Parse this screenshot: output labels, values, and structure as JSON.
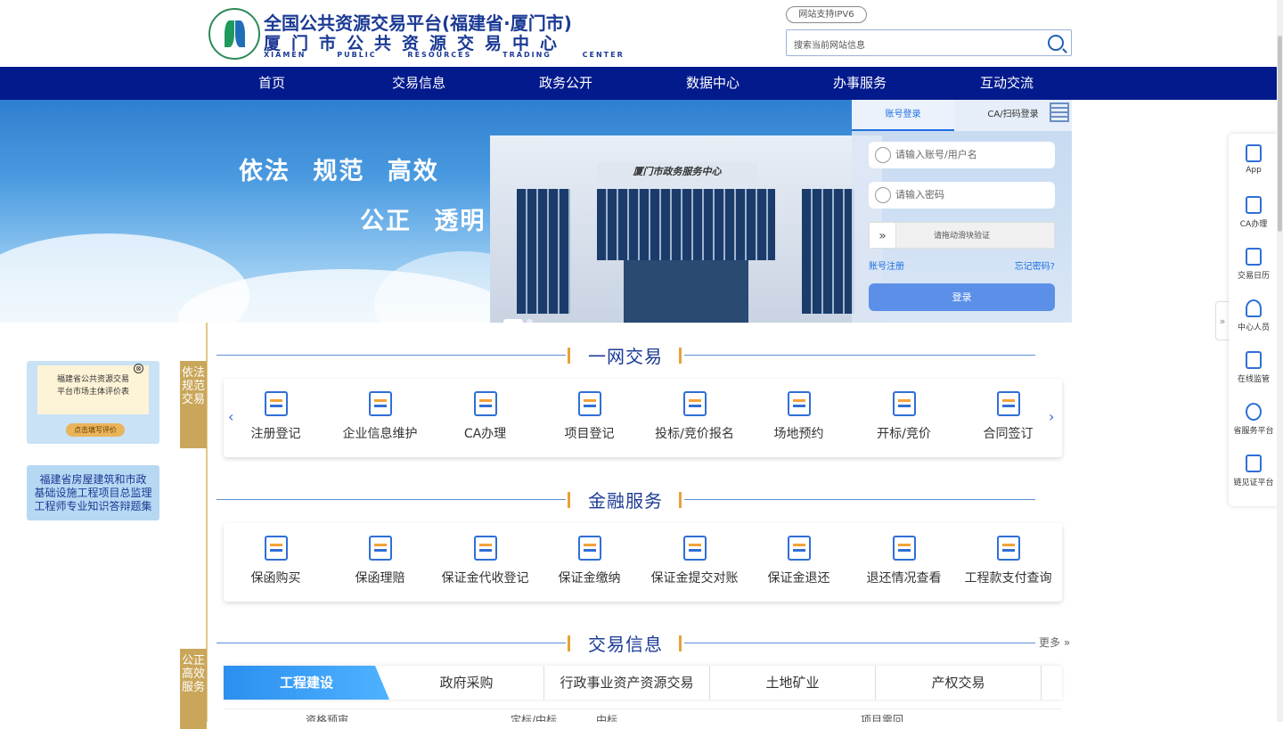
{
  "header": {
    "title_line1": "全国公共资源交易平台(福建省·厦门市)",
    "title_line2": "厦门市公共资源交易中心",
    "title_line3": "XIAMEN PUBLIC RESOURCES TRADING CENTER",
    "ipv6": "网站支持IPV6",
    "search_placeholder": "搜索当前网站信息"
  },
  "nav": [
    "首页",
    "交易信息",
    "政务公开",
    "数据中心",
    "办事服务",
    "互动交流"
  ],
  "banner": {
    "slogan1": "依法 规范 高效",
    "slogan2": "公正 透明",
    "sign": "厦门市政务服务中心"
  },
  "login": {
    "tab1": "账号登录",
    "tab2": "CA/扫码登录",
    "user_placeholder": "请输入账号/用户名",
    "pwd_placeholder": "请输入密码",
    "slider": "请拖动滑块验证",
    "register": "账号注册",
    "forgot": "忘记密码?",
    "submit": "登录"
  },
  "sections": {
    "s1": "一网交易",
    "s2": "金融服务",
    "s3": "交易信息",
    "more": "更多"
  },
  "trade_items": [
    "注册登记",
    "企业信息维护",
    "CA办理",
    "项目登记",
    "投标/竞价报名",
    "场地预约",
    "开标/竞价",
    "合同签订"
  ],
  "finance_items": [
    "保函购买",
    "保函理赔",
    "保证金代收登记",
    "保证金缴纳",
    "保证金提交对账",
    "保证金退还",
    "退还情况查看",
    "工程款支付查询"
  ],
  "info_tabs": [
    "工程建设",
    "政府采购",
    "行政事业资产资源交易",
    "土地矿业",
    "产权交易"
  ],
  "info_cols": [
    "资格预审",
    "定标/中标",
    "中标",
    "项目需回"
  ],
  "left": {
    "side1": "依法规范交易",
    "side2": "公正高效服务",
    "ad1_line1": "福建省公共资源交易",
    "ad1_line2": "平台市场主体评价表",
    "ad1_btn": "点击填写评价",
    "ad1_close": "⊗",
    "ad2_line1": "福建省房屋建筑和市政",
    "ad2_line2": "基础设施工程项目总监理",
    "ad2_line3": "工程师专业知识答辩题集"
  },
  "right_bar": [
    "App",
    "CA办理",
    "交易日历",
    "中心人员",
    "在线监管",
    "省服务平台",
    "链见证平台"
  ],
  "colors": {
    "nav_bg": "#031a8d",
    "brand_blue": "#1b3a94",
    "accent": "#2b8ff0",
    "gold": "#c9a65a"
  }
}
